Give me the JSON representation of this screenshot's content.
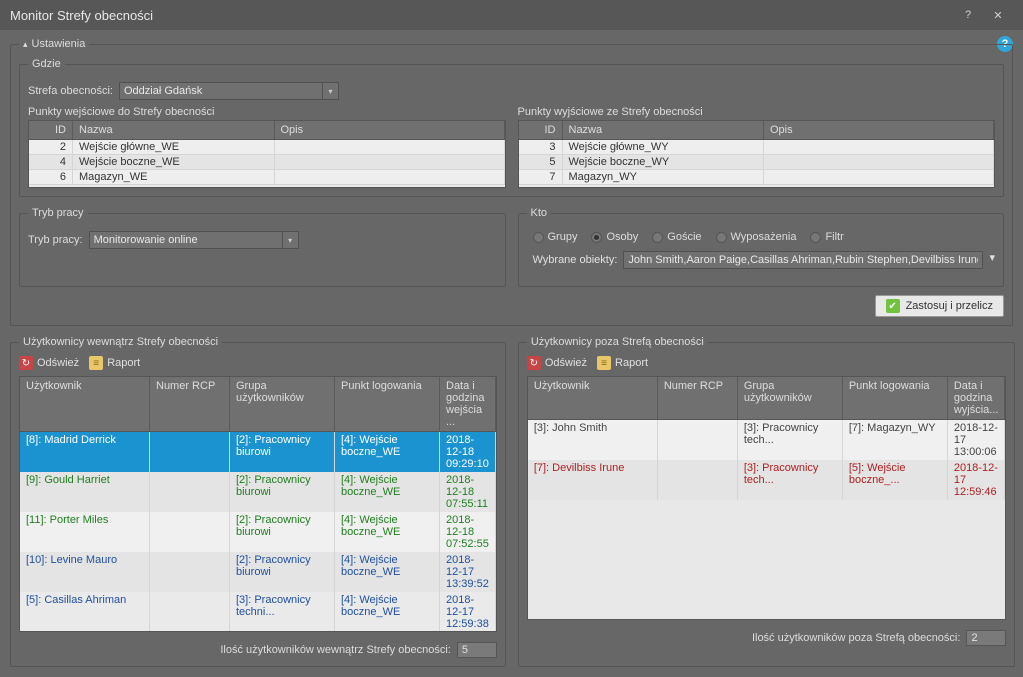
{
  "window": {
    "title": "Monitor Strefy obecności"
  },
  "settings": {
    "legend": "Ustawienia",
    "where": {
      "legend": "Gdzie",
      "zone_label": "Strefa obecności:",
      "zone_value": "Oddział Gdańsk",
      "entry_title": "Punkty wejściowe do Strefy obecności",
      "exit_title": "Punkty wyjściowe ze Strefy obecności",
      "col_id": "ID",
      "col_name": "Nazwa",
      "col_desc": "Opis",
      "entry_points": [
        {
          "id": "2",
          "name": "Wejście główne_WE",
          "desc": ""
        },
        {
          "id": "4",
          "name": "Wejście boczne_WE",
          "desc": ""
        },
        {
          "id": "6",
          "name": "Magazyn_WE",
          "desc": ""
        }
      ],
      "exit_points": [
        {
          "id": "3",
          "name": "Wejście główne_WY",
          "desc": ""
        },
        {
          "id": "5",
          "name": "Wejście boczne_WY",
          "desc": ""
        },
        {
          "id": "7",
          "name": "Magazyn_WY",
          "desc": ""
        }
      ]
    },
    "mode": {
      "legend": "Tryb pracy",
      "label": "Tryb pracy:",
      "value": "Monitorowanie online"
    },
    "who": {
      "legend": "Kto",
      "opts": {
        "groups": "Grupy",
        "persons": "Osoby",
        "guests": "Goście",
        "equip": "Wyposażenia",
        "filter": "Filtr"
      },
      "selected": "persons",
      "objects_label": "Wybrane obiekty:",
      "objects_value": "John Smith,Aaron Paige,Casillas Ahriman,Rubin Stephen,Devilbiss Irune,Madrid Derrick,Gould Harriet,..."
    },
    "apply_label": "Zastosuj i przelicz"
  },
  "inside": {
    "legend": "Użytkownicy wewnątrz Strefy obecności",
    "refresh": "Odśwież",
    "report": "Raport",
    "cols": {
      "user": "Użytkownik",
      "rcp": "Numer RCP",
      "group": "Grupa użytkowników",
      "point": "Punkt logowania",
      "date": "Data i godzina wejścia ..."
    },
    "rows": [
      {
        "user": "[8]: Madrid Derrick",
        "rcp": "",
        "group": "[2]: Pracownicy biurowi",
        "point": "[4]: Wejście boczne_WE",
        "date": "2018-12-18 09:29:10",
        "style": "sel"
      },
      {
        "user": "[9]: Gould Harriet",
        "rcp": "",
        "group": "[2]: Pracownicy biurowi",
        "point": "[4]: Wejście boczne_WE",
        "date": "2018-12-18 07:55:11",
        "style": "green"
      },
      {
        "user": "[11]: Porter Miles",
        "rcp": "",
        "group": "[2]: Pracownicy biurowi",
        "point": "[4]: Wejście boczne_WE",
        "date": "2018-12-18 07:52:55",
        "style": "green"
      },
      {
        "user": "[10]: Levine Mauro",
        "rcp": "",
        "group": "[2]: Pracownicy biurowi",
        "point": "[4]: Wejście boczne_WE",
        "date": "2018-12-17 13:39:52",
        "style": "blue"
      },
      {
        "user": "[5]: Casillas Ahriman",
        "rcp": "",
        "group": "[3]: Pracownicy techni...",
        "point": "[4]: Wejście boczne_WE",
        "date": "2018-12-17 12:59:38",
        "style": "blue"
      }
    ],
    "footer_label": "Ilość użytkowników wewnątrz Strefy obecności:",
    "footer_count": "5"
  },
  "outside": {
    "legend": "Użytkownicy poza Strefą obecności",
    "refresh": "Odśwież",
    "report": "Raport",
    "cols": {
      "user": "Użytkownik",
      "rcp": "Numer RCP",
      "group": "Grupa użytkowników",
      "point": "Punkt logowania",
      "date": "Data i godzina wyjścia..."
    },
    "rows": [
      {
        "user": "[3]: John Smith",
        "rcp": "",
        "group": "[3]: Pracownicy tech...",
        "point": "[7]: Magazyn_WY",
        "date": "2018-12-17 13:00:06",
        "style": "gray"
      },
      {
        "user": "[7]: Devilbiss Irune",
        "rcp": "",
        "group": "[3]: Pracownicy tech...",
        "point": "[5]: Wejście boczne_...",
        "date": "2018-12-17 12:59:46",
        "style": "red"
      }
    ],
    "footer_label": "Ilość użytkowników poza Strefą obecności:",
    "footer_count": "2"
  }
}
